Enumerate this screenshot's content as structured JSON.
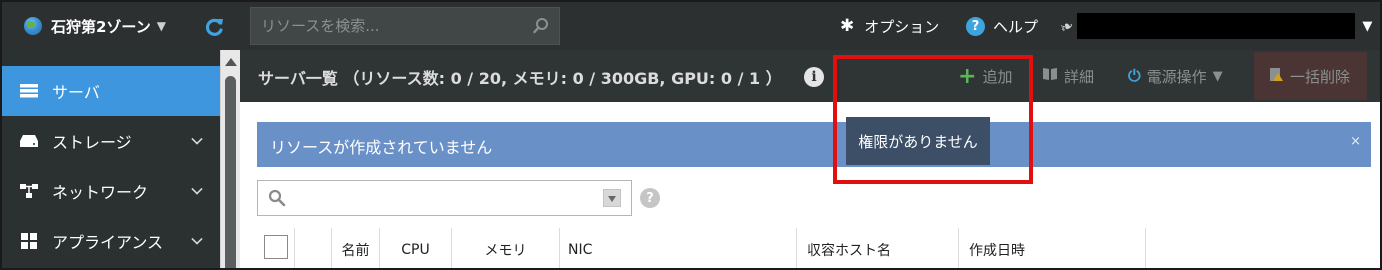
{
  "topbar": {
    "zone_label": "石狩第2ゾーン",
    "zone_caret": "▼",
    "search_placeholder": "リソースを検索...",
    "options_label": "オプション",
    "help_label": "ヘルプ",
    "user_caret": "▼"
  },
  "sidebar": {
    "items": [
      {
        "label": "サーバ",
        "icon": "server-icon",
        "active": true
      },
      {
        "label": "ストレージ",
        "icon": "storage-icon",
        "active": false
      },
      {
        "label": "ネットワーク",
        "icon": "network-icon",
        "active": false
      },
      {
        "label": "アプライアンス",
        "icon": "appliance-icon",
        "active": false
      }
    ]
  },
  "content": {
    "title": "サーバ一覧 （リソース数: 0 / 20, メモリ: 0 / 300GB, GPU: 0 / 1 ）",
    "info_icon": "i",
    "actions": {
      "add": "追加",
      "detail": "詳細",
      "power": "電源操作",
      "delete": "一括削除"
    },
    "alert_text": "リソースが作成されていません",
    "alert_close": "×",
    "tooltip": "権限がありません",
    "filter_help": "?",
    "columns": [
      "名前",
      "CPU",
      "メモリ",
      "NIC",
      "収容ホスト名",
      "作成日時"
    ]
  },
  "colors": {
    "topbar_bg": "#2c3030",
    "sidebar_active": "#3e96de",
    "alert_bg": "#6a90c8",
    "tooltip_bg": "#3d4f66",
    "highlight_border": "#e01010",
    "add_icon": "#5ab55a"
  }
}
